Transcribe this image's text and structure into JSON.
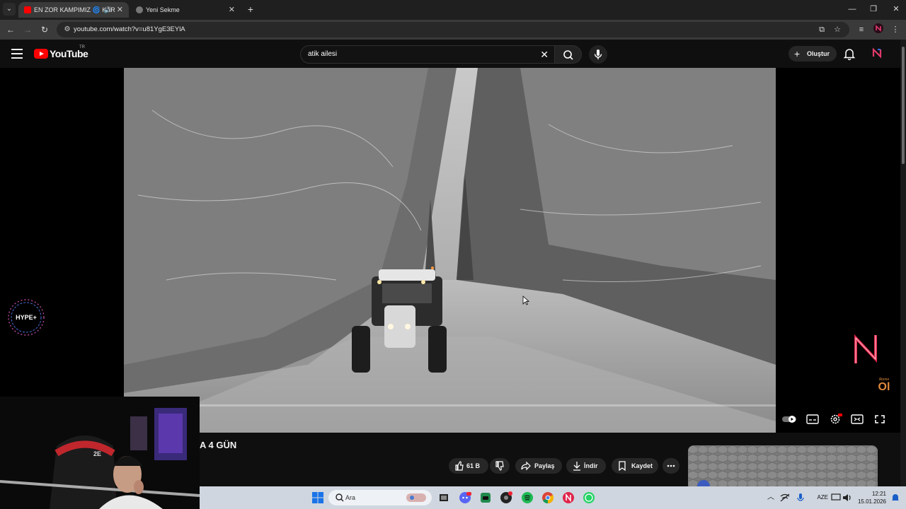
{
  "browser": {
    "tabs": [
      {
        "title": "EN ZOR KAMPIMIZ 🌀 KAR",
        "active": true
      },
      {
        "title": "Yeni Sekme",
        "active": false
      }
    ],
    "url": "youtube.com/watch?v=u81YgE3EYlA",
    "new_tab_label": "+"
  },
  "masthead": {
    "logo_text": "YouTube",
    "country_code": "TR",
    "search_query": "atik ailesi",
    "create_label": "Oluştur"
  },
  "video": {
    "title_fragment": "A 4 GÜN",
    "progress_fraction": 0.0
  },
  "actions": {
    "like_count": "61 B",
    "share_label": "Paylaş",
    "download_label": "İndir",
    "save_label": "Kaydet"
  },
  "overlays": {
    "hype_label": "HYPE+",
    "abone_small": "Abone",
    "abone_big": "Ol"
  },
  "taskbar": {
    "search_placeholder": "Ara",
    "lang": "AZE",
    "time": "12:21",
    "date": "15.01.2026"
  },
  "colors": {
    "youtube_red": "#ff0000",
    "background": "#0f0f0f",
    "taskbar": "#cfd6df"
  }
}
